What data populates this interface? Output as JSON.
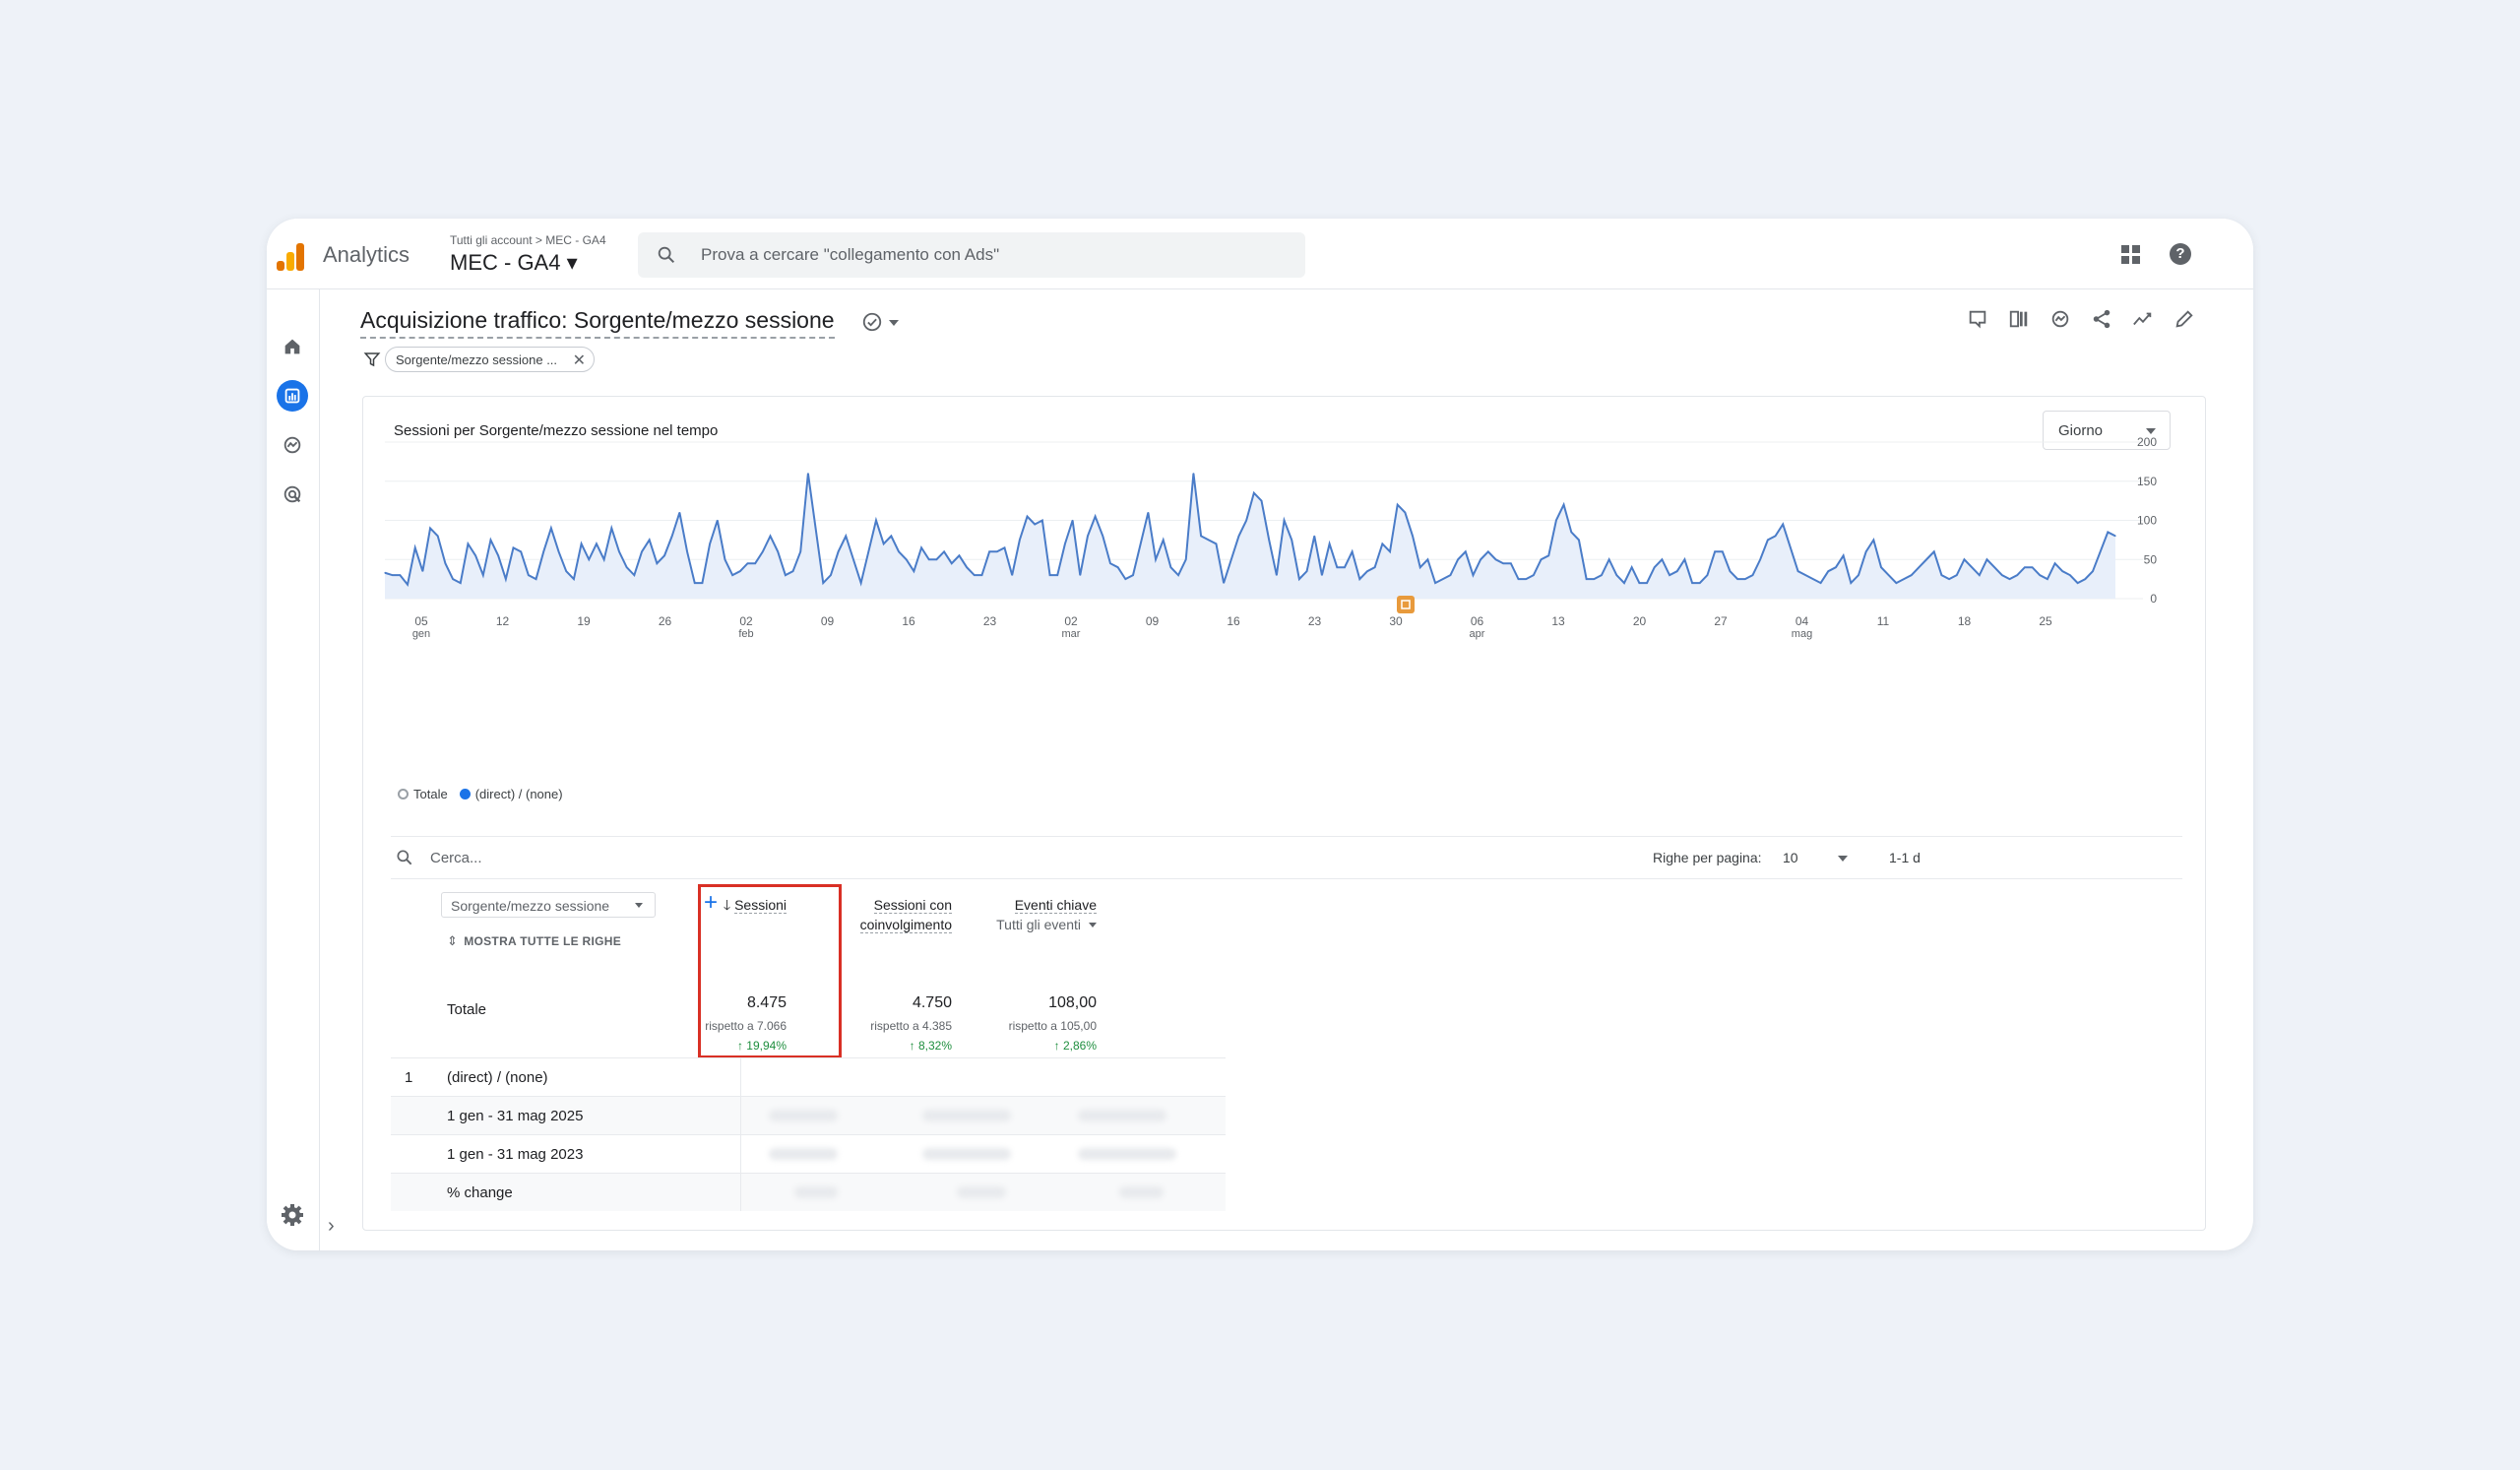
{
  "app": {
    "name": "Analytics",
    "breadcrumb": "Tutti gli account  >  MEC - GA4",
    "property": "MEC - GA4 ▾",
    "search_placeholder": "Prova a cercare \"collegamento con Ads\""
  },
  "report": {
    "title": "Acquisizione traffico: Sorgente/mezzo sessione",
    "filter_chip": "Sorgente/mezzo sessione ...",
    "chart_title": "Sessioni per Sorgente/mezzo sessione nel tempo",
    "granularity": "Giorno",
    "legend_total": "Totale",
    "legend_series": "(direct) / (none)"
  },
  "colors": {
    "accent": "#1a73e8",
    "line": "#4a7cc8",
    "area": "#e8effa",
    "highlight": "#d93025",
    "positive": "#1e8e3e",
    "annotation": "#e89a3c"
  },
  "chart_data": {
    "type": "area",
    "ylim": [
      0,
      200
    ],
    "yticks": [
      "200",
      "150",
      "100",
      "50",
      "0"
    ],
    "xticks": [
      {
        "day": "05",
        "month": "gen"
      },
      {
        "day": "12",
        "month": ""
      },
      {
        "day": "19",
        "month": ""
      },
      {
        "day": "26",
        "month": ""
      },
      {
        "day": "02",
        "month": "feb"
      },
      {
        "day": "09",
        "month": ""
      },
      {
        "day": "16",
        "month": ""
      },
      {
        "day": "23",
        "month": ""
      },
      {
        "day": "02",
        "month": "mar"
      },
      {
        "day": "09",
        "month": ""
      },
      {
        "day": "16",
        "month": ""
      },
      {
        "day": "23",
        "month": ""
      },
      {
        "day": "30",
        "month": ""
      },
      {
        "day": "06",
        "month": "apr"
      },
      {
        "day": "13",
        "month": ""
      },
      {
        "day": "20",
        "month": ""
      },
      {
        "day": "27",
        "month": ""
      },
      {
        "day": "04",
        "month": "mag"
      },
      {
        "day": "11",
        "month": ""
      },
      {
        "day": "18",
        "month": ""
      },
      {
        "day": "25",
        "month": ""
      }
    ],
    "series": [
      {
        "name": "(direct) / (none)",
        "values": [
          33,
          30,
          30,
          18,
          65,
          35,
          90,
          80,
          45,
          25,
          20,
          70,
          55,
          30,
          75,
          55,
          25,
          65,
          60,
          30,
          25,
          60,
          90,
          60,
          35,
          25,
          70,
          50,
          70,
          50,
          90,
          60,
          40,
          30,
          60,
          75,
          45,
          55,
          80,
          110,
          60,
          20,
          20,
          70,
          100,
          50,
          30,
          35,
          45,
          45,
          60,
          80,
          60,
          30,
          35,
          60,
          160,
          90,
          20,
          30,
          60,
          80,
          50,
          20,
          60,
          100,
          70,
          80,
          60,
          50,
          35,
          65,
          50,
          50,
          60,
          45,
          55,
          40,
          30,
          30,
          60,
          60,
          65,
          30,
          75,
          105,
          95,
          100,
          30,
          30,
          70,
          100,
          30,
          80,
          105,
          80,
          45,
          40,
          25,
          30,
          70,
          110,
          50,
          75,
          40,
          30,
          50,
          160,
          80,
          75,
          70,
          20,
          50,
          80,
          100,
          135,
          125,
          75,
          30,
          100,
          75,
          25,
          35,
          80,
          30,
          70,
          40,
          40,
          60,
          25,
          35,
          40,
          70,
          60,
          120,
          110,
          80,
          40,
          50,
          20,
          25,
          30,
          50,
          60,
          30,
          50,
          60,
          50,
          45,
          45,
          25,
          25,
          30,
          50,
          55,
          100,
          120,
          85,
          75,
          25,
          25,
          30,
          50,
          30,
          20,
          40,
          20,
          20,
          40,
          50,
          30,
          35,
          50,
          20,
          20,
          30,
          60,
          60,
          35,
          25,
          25,
          30,
          50,
          75,
          80,
          95,
          65,
          35,
          30,
          25,
          20,
          35,
          40,
          55,
          20,
          30,
          60,
          75,
          40,
          30,
          20,
          25,
          30,
          40,
          50,
          60,
          30,
          25,
          30,
          50,
          40,
          30,
          50,
          40,
          30,
          25,
          30,
          40,
          40,
          30,
          25,
          45,
          35,
          30,
          20,
          25,
          35,
          60,
          85,
          80
        ]
      }
    ],
    "annotation_marker": "30 mar"
  },
  "table": {
    "search_placeholder": "Cerca...",
    "rows_per_page_label": "Righe per pagina:",
    "rows_per_page": "10",
    "range": "1-1 d",
    "dimension": "Sorgente/mezzo sessione",
    "show_all_rows": "MOSTRA TUTTE LE RIGHE",
    "columns": {
      "sessions": "Sessioni",
      "engaged_1": "Sessioni con",
      "engaged_2": "coinvolgimento",
      "events": "Eventi chiave",
      "events_sub": "Tutti gli eventi"
    },
    "totals": {
      "label": "Totale",
      "sessions": {
        "value": "8.475",
        "compare": "rispetto a 7.066",
        "change": "↑ 19,94%"
      },
      "engaged": {
        "value": "4.750",
        "compare": "rispetto a 4.385",
        "change": "↑ 8,32%"
      },
      "events": {
        "value": "108,00",
        "compare": "rispetto a 105,00",
        "change": "↑ 2,86%"
      }
    },
    "rows": [
      {
        "index": "1",
        "label": "(direct) / (none)"
      },
      {
        "index": "",
        "label": "1 gen - 31 mag 2025"
      },
      {
        "index": "",
        "label": "1 gen - 31 mag 2023"
      },
      {
        "index": "",
        "label": "% change"
      }
    ]
  }
}
